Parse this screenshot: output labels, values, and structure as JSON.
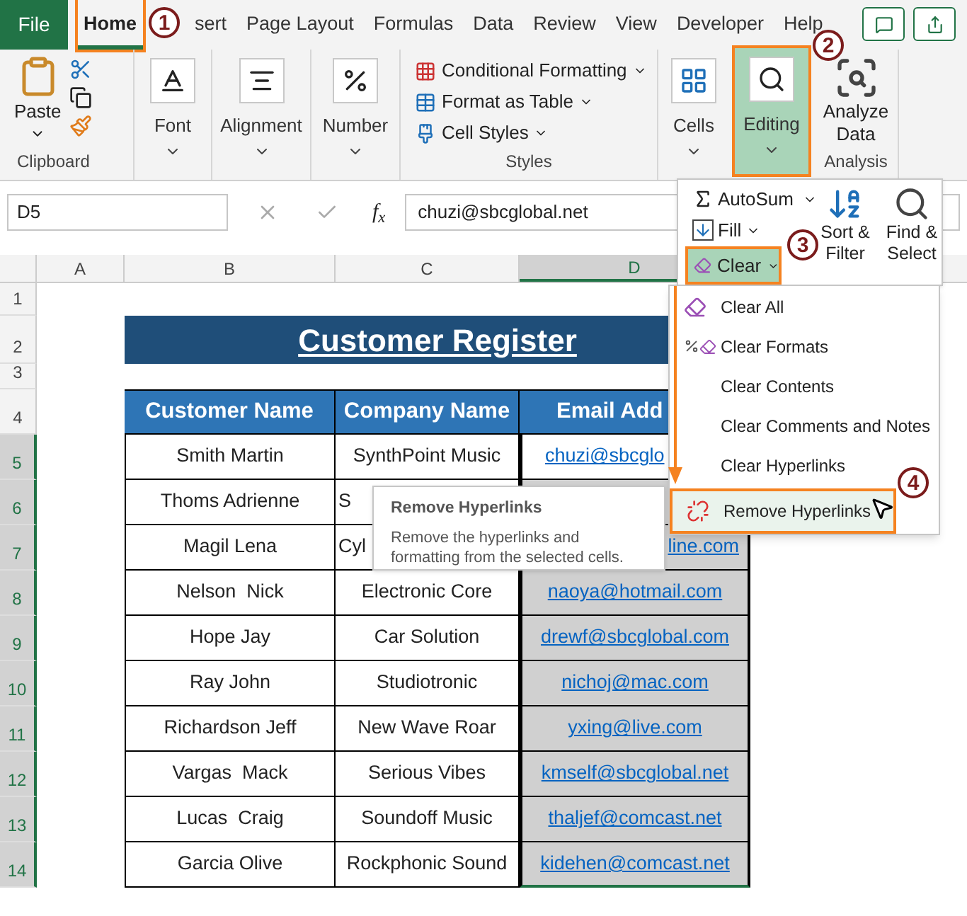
{
  "ribbon_tabs": [
    {
      "label": "File",
      "kind": "file",
      "selected": false
    },
    {
      "label": "Home",
      "kind": "tab",
      "selected": true
    },
    {
      "label": "sert",
      "kind": "tab",
      "selected": false
    },
    {
      "label": "Page Layout",
      "kind": "tab",
      "selected": false
    },
    {
      "label": "Formulas",
      "kind": "tab",
      "selected": false
    },
    {
      "label": "Data",
      "kind": "tab",
      "selected": false
    },
    {
      "label": "Review",
      "kind": "tab",
      "selected": false
    },
    {
      "label": "View",
      "kind": "tab",
      "selected": false
    },
    {
      "label": "Developer",
      "kind": "tab",
      "selected": false
    },
    {
      "label": "Help",
      "kind": "tab",
      "selected": false
    }
  ],
  "clipboard": {
    "paste": "Paste",
    "label": "Clipboard"
  },
  "font": "Font",
  "alignment": "Alignment",
  "number": "Number",
  "styles": {
    "items": [
      "Conditional Formatting",
      "Format as Table",
      "Cell Styles"
    ],
    "label": "Styles"
  },
  "cells": "Cells",
  "editing": {
    "label": "Editing",
    "selected": true
  },
  "analysis": {
    "button": "Analyze Data",
    "label": "Analysis"
  },
  "name_box": "D5",
  "function_label": "f$_{x}$",
  "formula": "chuzi@sbcglobal.net",
  "columns": [
    {
      "label": "A",
      "selected": false
    },
    {
      "label": "B",
      "selected": false
    },
    {
      "label": "C",
      "selected": false
    },
    {
      "label": "D",
      "selected": true
    }
  ],
  "sheet_rows": [
    {
      "label": "1",
      "selected": false
    },
    {
      "label": "2",
      "selected": false
    },
    {
      "label": "3",
      "selected": false
    },
    {
      "label": "4",
      "selected": false
    },
    {
      "label": "5",
      "selected": true
    },
    {
      "label": "6",
      "selected": true
    },
    {
      "label": "7",
      "selected": true
    },
    {
      "label": "8",
      "selected": true
    },
    {
      "label": "9",
      "selected": true
    },
    {
      "label": "10",
      "selected": true
    },
    {
      "label": "11",
      "selected": true
    },
    {
      "label": "12",
      "selected": true
    },
    {
      "label": "13",
      "selected": true
    },
    {
      "label": "14",
      "selected": true
    }
  ],
  "title": "Customer Register",
  "table": {
    "columns": [
      "Customer Name",
      "Company Name",
      "Email Add"
    ],
    "rows": [
      {
        "customer": "Smith Martin",
        "company": "SynthPoint Music",
        "email": "chuzi@sbcglo",
        "email_cut_end": true,
        "shaded": false
      },
      {
        "customer": "Thoms Adrienne",
        "company": "S",
        "company_cut": true,
        "shaded": true
      },
      {
        "customer": "Magil Lena",
        "company": "Cyl",
        "company_cut": true,
        "email": "line.com",
        "email_cut_start": true,
        "shaded": true
      },
      {
        "customer": "Nelson  Nick",
        "company": "Electronic Core",
        "email": "naoya@hotmail.com",
        "shaded": true
      },
      {
        "customer": "Hope Jay",
        "company": "Car Solution",
        "email": "drewf@sbcglobal.com",
        "shaded": true
      },
      {
        "customer": "Ray John",
        "company": "Studiotronic",
        "email": "nichoj@mac.com",
        "shaded": true
      },
      {
        "customer": "Richardson Jeff",
        "company": "New Wave Roar",
        "email": "yxing@live.com",
        "shaded": true
      },
      {
        "customer": "Vargas  Mack",
        "company": "Serious Vibes",
        "email": "kmself@sbcglobal.net",
        "shaded": true
      },
      {
        "customer": "Lucas  Craig",
        "company": "Soundoff Music",
        "email": "thaljef@comcast.net",
        "shaded": true
      },
      {
        "customer": "Garcia Olive",
        "company": "Rockphonic Sound",
        "email": "kidehen@comcast.net",
        "shaded": true
      }
    ]
  },
  "editing_panel": {
    "autosum": "AutoSum",
    "fill": "Fill",
    "clear": "Clear",
    "clear_selected": true,
    "sort": "Sort & Filter",
    "find": "Find & Select"
  },
  "clear_menu": [
    {
      "label": "Clear All",
      "selected": false
    },
    {
      "label": "Clear Formats",
      "selected": false
    },
    {
      "label": "Clear Contents",
      "selected": false
    },
    {
      "label": "Clear Comments and Notes",
      "selected": false
    },
    {
      "label": "Clear Hyperlinks",
      "selected": false
    },
    {
      "label": "Remove Hyperlinks",
      "selected": true
    }
  ],
  "tooltip": {
    "title": "Remove Hyperlinks",
    "text": "Remove the hyperlinks and formatting from the selected cells."
  },
  "steps": [
    "1",
    "2",
    "3",
    "4"
  ]
}
